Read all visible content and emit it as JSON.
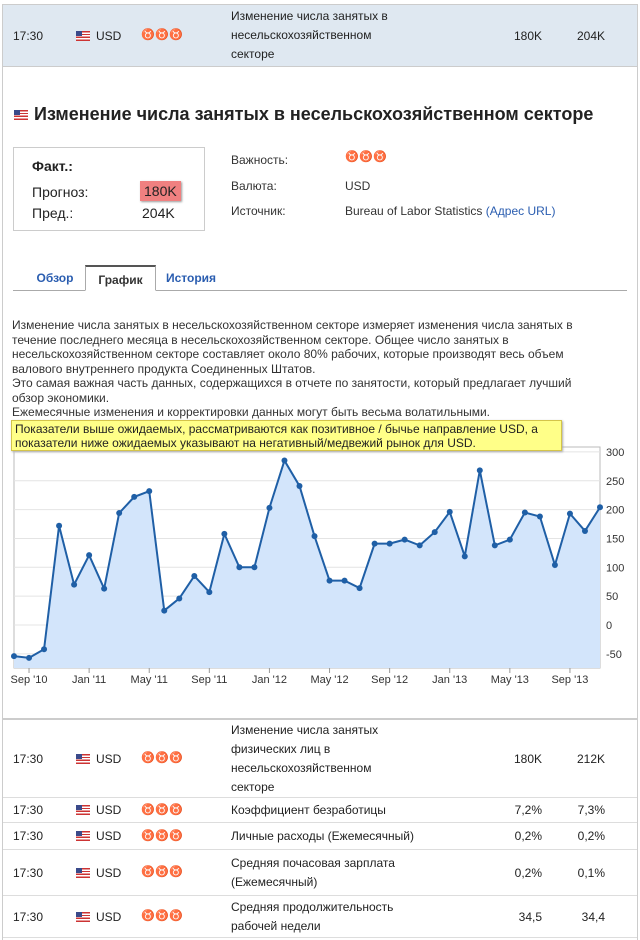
{
  "top_row": {
    "time": "17:30",
    "currency": "USD",
    "importance": 3,
    "event": "Изменение числа занятых в несельскохозяйственном секторе",
    "forecast": "180K",
    "previous": "204K"
  },
  "detail": {
    "title": "Изменение числа занятых в несельскохозяйственном секторе",
    "actual_label": "Факт.:",
    "forecast_label": "Прогноз:",
    "forecast_value": "180K",
    "previous_label": "Пред.:",
    "previous_value": "204K",
    "importance_label": "Важность:",
    "importance": 3,
    "currency_label": "Валюта:",
    "currency": "USD",
    "source_label": "Источник:",
    "source": "Bureau of Labor Statistics",
    "source_link": "(Адрес URL)"
  },
  "tabs": [
    {
      "label": "Обзор"
    },
    {
      "label": "График"
    },
    {
      "label": "История"
    }
  ],
  "description": [
    "Изменение числа занятых в несельскохозяйственном секторе измеряет изменения числа занятых в течение последнего месяца в несельскохозяйственном секторе. Общее число занятых в несельскохозяйственном секторе составляет около 80% рабочих, которые производят весь объем валового внутреннего продукта Соединенных Штатов.",
    "Это самая важная часть данных, содержащихся в отчете по занятости, который предлагает лучший обзор экономики.",
    "Ежемесячные изменения и корректировки данных могут быть весьма волатильными."
  ],
  "tooltip": "Показатели выше ожидаемых, рассматриваются как позитивное / бычье направление USD, а показатели ниже ожидаемых указывают на негативный/медвежий рынок для USD.",
  "chart_data": {
    "type": "area",
    "title": "",
    "x_start": "Aug 2010",
    "x_ticks": [
      "Sep '10",
      "Jan '11",
      "May '11",
      "Sep '11",
      "Jan '12",
      "May '12",
      "Sep '12",
      "Jan '13",
      "May '13",
      "Sep '13"
    ],
    "x_tick_index": [
      1,
      5,
      9,
      13,
      17,
      21,
      25,
      29,
      33,
      37
    ],
    "y_ticks": [
      -50,
      0,
      50,
      100,
      150,
      200,
      250,
      300
    ],
    "ylim": [
      -75,
      300
    ],
    "values": [
      -54,
      -57,
      -42,
      172,
      70,
      121,
      63,
      194,
      222,
      232,
      25,
      46,
      85,
      57,
      158,
      100,
      100,
      203,
      285,
      241,
      154,
      77,
      77,
      64,
      141,
      141,
      148,
      138,
      161,
      196,
      119,
      268,
      138,
      148,
      195,
      188,
      104,
      193,
      163,
      204
    ],
    "grid": true,
    "line_color": "#1f5fa6",
    "fill_color": "#d3e5fb"
  },
  "rows": [
    {
      "time": "17:30",
      "currency": "USD",
      "importance": 2,
      "event": "Изменение числа занятых физических лиц в несельскохозяйственном секторе",
      "forecast": "180K",
      "previous": "212K"
    },
    {
      "time": "17:30",
      "currency": "USD",
      "importance": 3,
      "event": "Коэффициент безработицы",
      "forecast": "7,2%",
      "previous": "7,3%"
    },
    {
      "time": "17:30",
      "currency": "USD",
      "importance": 2,
      "event": "Личные расходы (Ежемесячный)",
      "forecast": "0,2%",
      "previous": "0,2%"
    },
    {
      "time": "17:30",
      "currency": "USD",
      "importance": 2,
      "event": "Средняя почасовая зарплата (Ежемесячный)",
      "forecast": "0,2%",
      "previous": "0,1%"
    },
    {
      "time": "17:30",
      "currency": "USD",
      "importance": 2,
      "event": "Средняя продолжительность рабочей недели",
      "forecast": "34,5",
      "previous": "34,4"
    }
  ]
}
